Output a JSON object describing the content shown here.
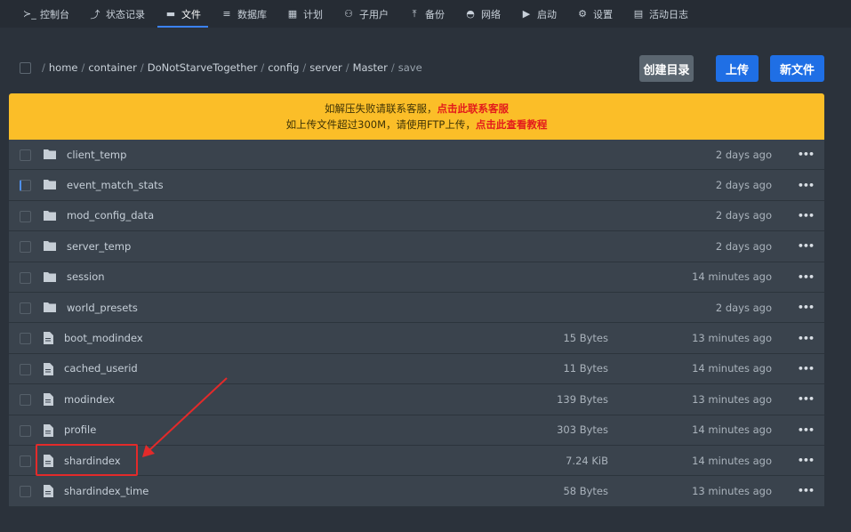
{
  "nav": {
    "items": [
      {
        "icon": "terminal-icon",
        "glyph": "≻_",
        "label": "控制台"
      },
      {
        "icon": "chart-icon",
        "glyph": "⤴",
        "label": "状态记录"
      },
      {
        "icon": "folder-open-icon",
        "glyph": "▬",
        "label": "文件"
      },
      {
        "icon": "database-icon",
        "glyph": "≡",
        "label": "数据库"
      },
      {
        "icon": "calendar-icon",
        "glyph": "▦",
        "label": "计划"
      },
      {
        "icon": "users-icon",
        "glyph": "⚇",
        "label": "子用户"
      },
      {
        "icon": "upload-icon",
        "glyph": "⤒",
        "label": "备份"
      },
      {
        "icon": "network-icon",
        "glyph": "◓",
        "label": "网络"
      },
      {
        "icon": "play-icon",
        "glyph": "▶",
        "label": "启动"
      },
      {
        "icon": "gear-icon",
        "glyph": "⚙",
        "label": "设置"
      },
      {
        "icon": "log-icon",
        "glyph": "▤",
        "label": "活动日志"
      }
    ],
    "active_index": 2
  },
  "breadcrumb": {
    "separator": "/",
    "segments": [
      "home",
      "container",
      "DoNotStarveTogether",
      "config",
      "server",
      "Master",
      "save"
    ]
  },
  "buttons": {
    "mkdir": "创建目录",
    "upload": "上传",
    "new_file": "新文件"
  },
  "notice": {
    "line1_text": "如解压失败请联系客服，",
    "line1_link": "点击此联系客服",
    "line2_text": "如上传文件超过300M，请使用FTP上传，",
    "line2_link": "点击此查看教程"
  },
  "files": [
    {
      "name": "client_temp",
      "type": "folder",
      "size": "",
      "modified": "2 days ago"
    },
    {
      "name": "event_match_stats",
      "type": "folder",
      "size": "",
      "modified": "2 days ago"
    },
    {
      "name": "mod_config_data",
      "type": "folder",
      "size": "",
      "modified": "2 days ago"
    },
    {
      "name": "server_temp",
      "type": "folder",
      "size": "",
      "modified": "2 days ago"
    },
    {
      "name": "session",
      "type": "folder",
      "size": "",
      "modified": "14 minutes ago"
    },
    {
      "name": "world_presets",
      "type": "folder",
      "size": "",
      "modified": "2 days ago"
    },
    {
      "name": "boot_modindex",
      "type": "file",
      "size": "15 Bytes",
      "modified": "13 minutes ago"
    },
    {
      "name": "cached_userid",
      "type": "file",
      "size": "11 Bytes",
      "modified": "14 minutes ago"
    },
    {
      "name": "modindex",
      "type": "file",
      "size": "139 Bytes",
      "modified": "13 minutes ago"
    },
    {
      "name": "profile",
      "type": "file",
      "size": "303 Bytes",
      "modified": "14 minutes ago"
    },
    {
      "name": "shardindex",
      "type": "file",
      "size": "7.24 KiB",
      "modified": "14 minutes ago"
    },
    {
      "name": "shardindex_time",
      "type": "file",
      "size": "58 Bytes",
      "modified": "13 minutes ago"
    }
  ],
  "row_menu_label": "•••",
  "colors": {
    "accent": "#1f6fe5",
    "notice_bg": "#fbbe28",
    "notice_link": "#e31b1b",
    "annotation": "#e32a2a"
  }
}
